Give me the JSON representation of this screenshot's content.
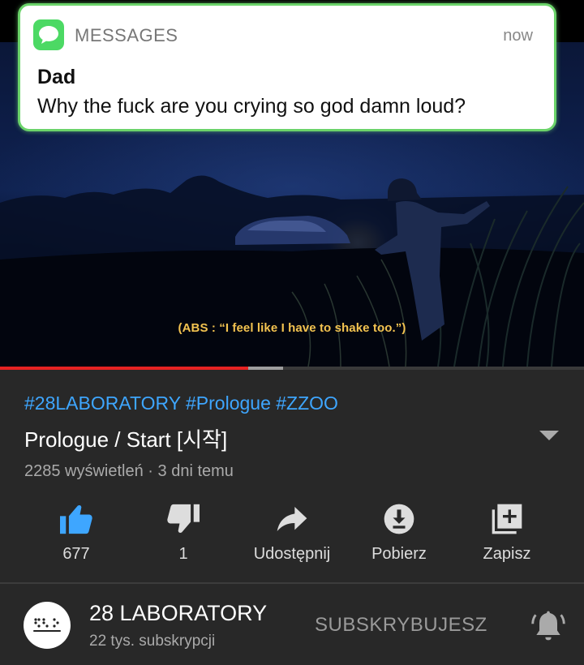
{
  "notification": {
    "app_name": "MESSAGES",
    "time": "now",
    "sender": "Dad",
    "body": "Why the fuck are you crying so god damn loud?"
  },
  "video": {
    "subtitle": "(ABS : “I feel like I have to shake too.”)",
    "progress_played": 0.425,
    "progress_buffered": 0.485
  },
  "info": {
    "hashtags": "#28LABORATORY #Prologue #ZZOO",
    "title": "Prologue / Start [시작]",
    "meta": "2285 wyświetleń · 3 dni temu"
  },
  "actions": [
    {
      "label": "677",
      "icon": "thumbs-up-icon"
    },
    {
      "label": "1",
      "icon": "thumbs-down-icon"
    },
    {
      "label": "Udostępnij",
      "icon": "share-icon"
    },
    {
      "label": "Pobierz",
      "icon": "download-icon"
    },
    {
      "label": "Zapisz",
      "icon": "add-to-playlist-icon"
    }
  ],
  "channel": {
    "name": "28 LABORATORY",
    "subscribers": "22 tys. subskrypcji",
    "subscribe_label": "SUBSKRYBUJESZ"
  },
  "colors": {
    "accent_blue": "#3ea6ff",
    "like_blue": "#3ea6ff",
    "progress_red": "#e52222",
    "background": "#282828",
    "messages_green": "#4cd964",
    "subtitle_yellow": "#f3c350"
  }
}
